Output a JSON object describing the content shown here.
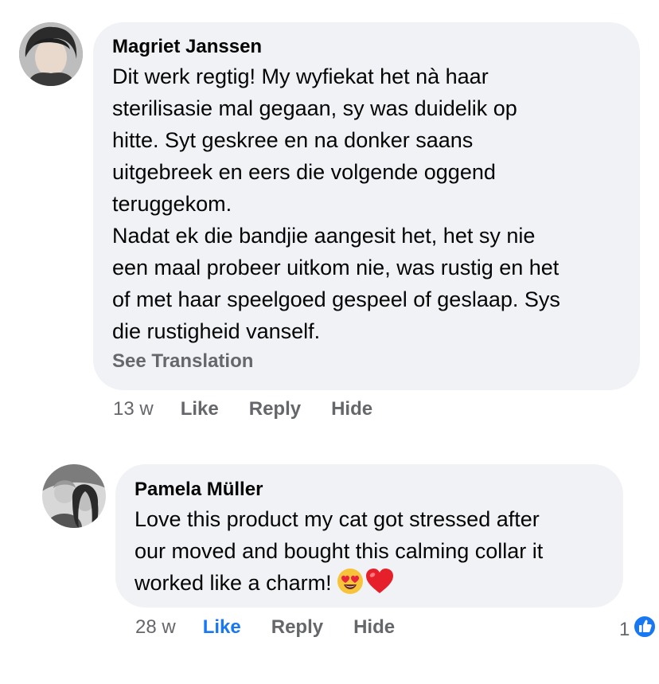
{
  "comments": [
    {
      "author": "Magriet Janssen",
      "lines": [
        "Dit werk regtig! My wyfiekat het nà haar",
        "sterilisasie mal gegaan, sy was duidelik op",
        "hitte. Syt geskree en na donker saans",
        "uitgebreek en eers die volgende oggend",
        "teruggekom.",
        "Nadat ek die bandjie aangesit het, het sy nie",
        "een maal probeer uitkom nie, was rustig en het",
        "of met haar speelgoed gespeel of geslaap. Sys",
        "die rustigheid vanself."
      ],
      "see_translation": "See Translation",
      "time": "13 w",
      "like": "Like",
      "reply": "Reply",
      "hide": "Hide"
    },
    {
      "author": "Pamela Müller",
      "lines": [
        "Love this product my cat got stressed after",
        "our moved and bought this calming collar it",
        "worked like a charm!"
      ],
      "emojis": [
        "smiling-face-with-heart-eyes",
        "red-heart"
      ],
      "time": "28 w",
      "like": "Like",
      "reply": "Reply",
      "hide": "Hide",
      "reaction_count": "1",
      "reaction_icon": "thumbs-up-icon",
      "like_active_color": "#1877f2"
    }
  ],
  "colors": {
    "bubble": "#f0f2f5",
    "secondary_text": "#65676b",
    "primary_text": "#050505",
    "accent": "#1877f2"
  }
}
